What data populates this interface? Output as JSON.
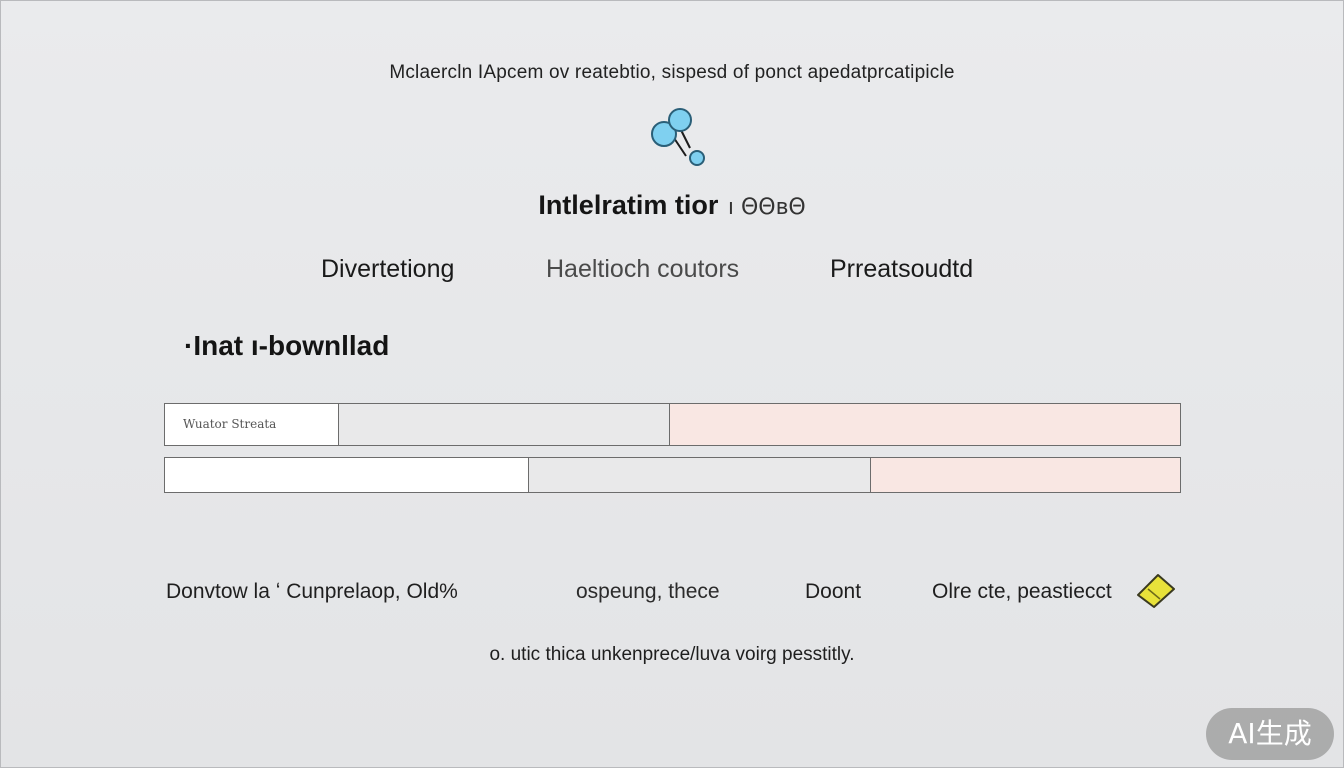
{
  "header": {
    "top_text": "Mclaercln  IApcem ov reatebtio,  sispesd  of ponct apedatprcatipicle",
    "title": "Intlelratim tior",
    "title_suffix": "ı ΘΘʙΘ"
  },
  "tabs": [
    {
      "label": "Divertetiong"
    },
    {
      "label": "Haeltioch coutors"
    },
    {
      "label": "Prreatsoudtd"
    }
  ],
  "section": {
    "title": "·Inat ı-bownllad"
  },
  "table": {
    "row1_cell1_text": "Wuator Streata"
  },
  "bottom_items": [
    {
      "label": "Donvtow la ʻ Cunprelaop, Old%"
    },
    {
      "label": "ospeung, thece"
    },
    {
      "label": "Doont"
    },
    {
      "label": "Olre cte, peastiecct"
    }
  ],
  "footer": {
    "text": "o. utic thica unkenprece/luva voirg pesstitly."
  },
  "badge": {
    "text": "AI生成"
  },
  "icons": {
    "logo": "molecule-icon",
    "ticket": "ticket-icon"
  },
  "colors": {
    "logo_blue": "#7fd0f0",
    "pink_cell": "#f9e7e3",
    "ticket_yellow": "#e8e23a"
  }
}
